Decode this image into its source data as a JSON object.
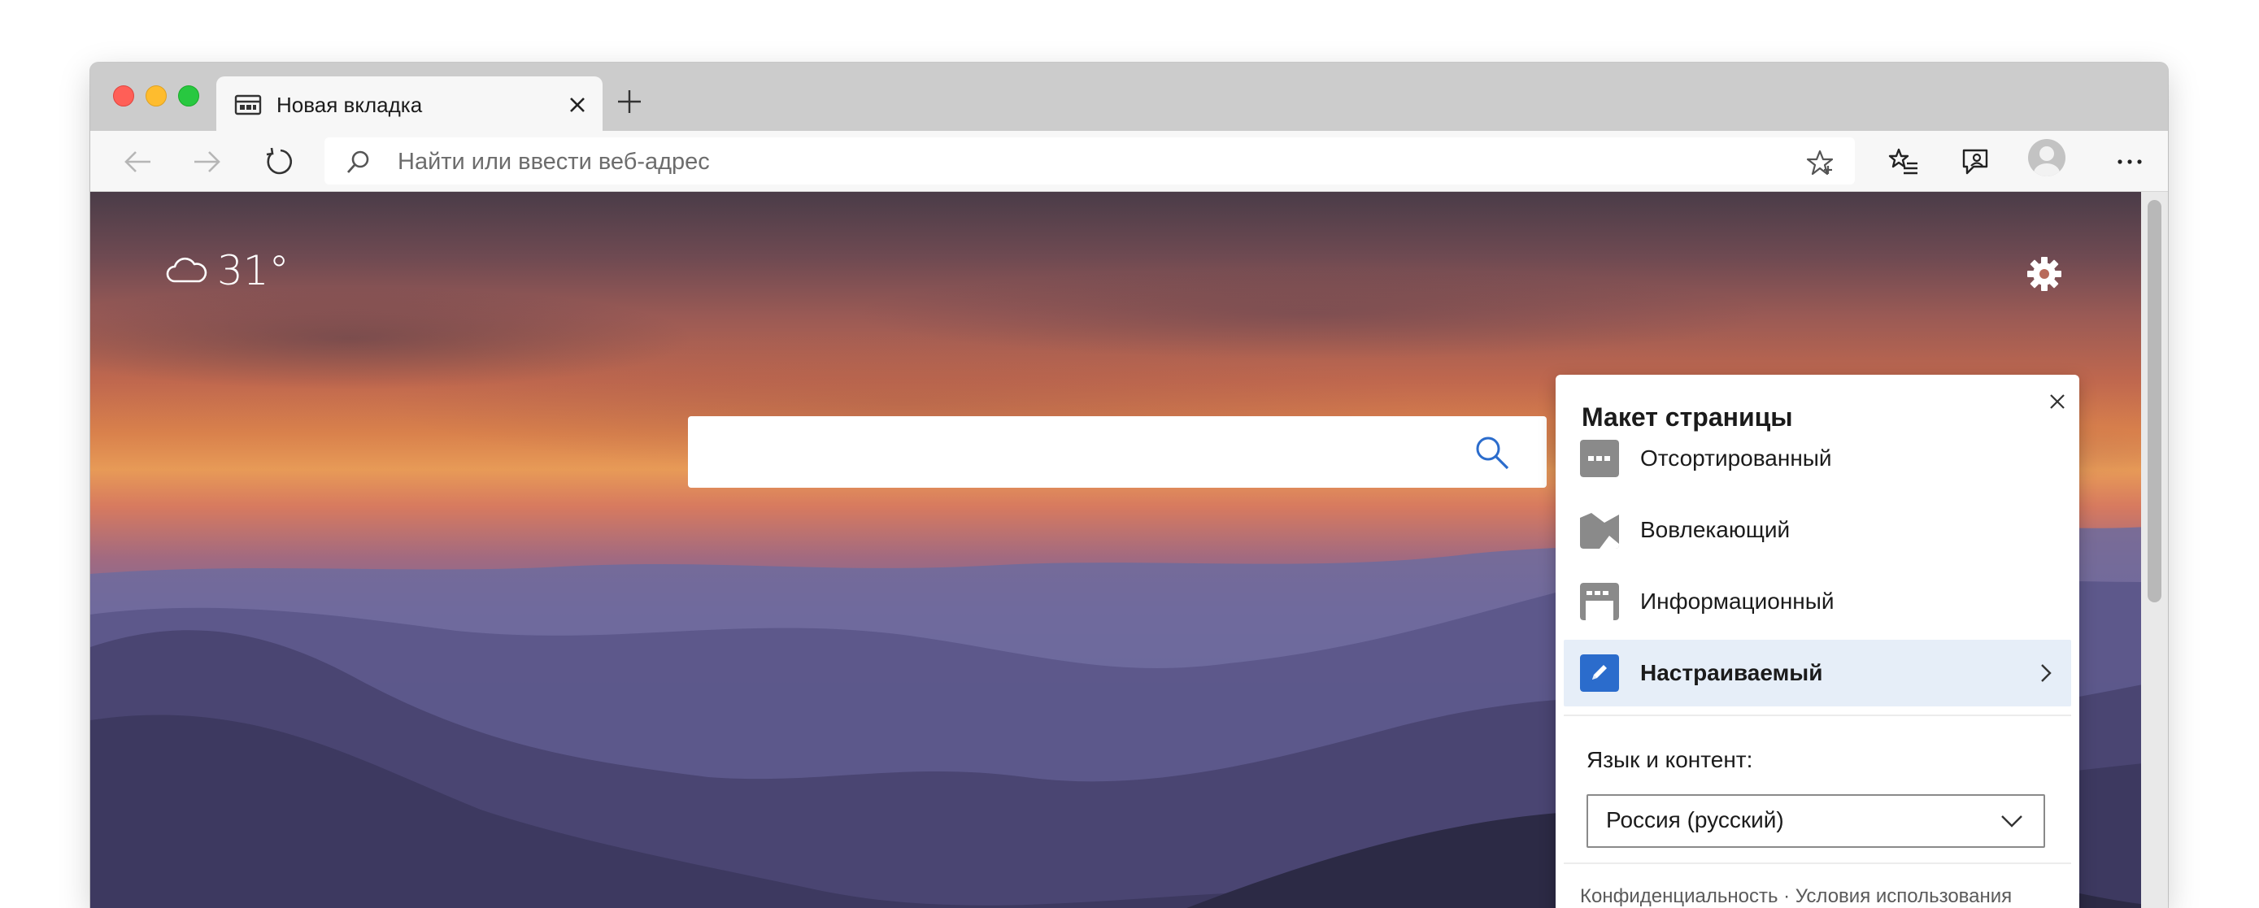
{
  "tab": {
    "title": "Новая вкладка"
  },
  "address": {
    "placeholder": "Найти или ввести веб-адрес"
  },
  "weather": {
    "temperature": "31°",
    "icon": "cloud-icon"
  },
  "search": {
    "placeholder": ""
  },
  "layout_panel": {
    "title": "Макет страницы",
    "options": [
      {
        "label": "Отсортированный",
        "icon": "focused-layout-icon",
        "selected": false
      },
      {
        "label": "Вовлекающий",
        "icon": "inspirational-layout-icon",
        "selected": false
      },
      {
        "label": "Информационный",
        "icon": "informational-layout-icon",
        "selected": false
      },
      {
        "label": "Настраиваемый",
        "icon": "custom-layout-icon",
        "selected": true
      }
    ],
    "language_label": "Язык и контент:",
    "language_value": "Россия (русский)",
    "footer": {
      "privacy": "Конфиденциальность",
      "separator": " · ",
      "terms": "Условия использования"
    }
  },
  "colors": {
    "accent": "#2b6ccc",
    "selected_row": "#e6eef8",
    "icon_gray": "#8a8a8a"
  }
}
